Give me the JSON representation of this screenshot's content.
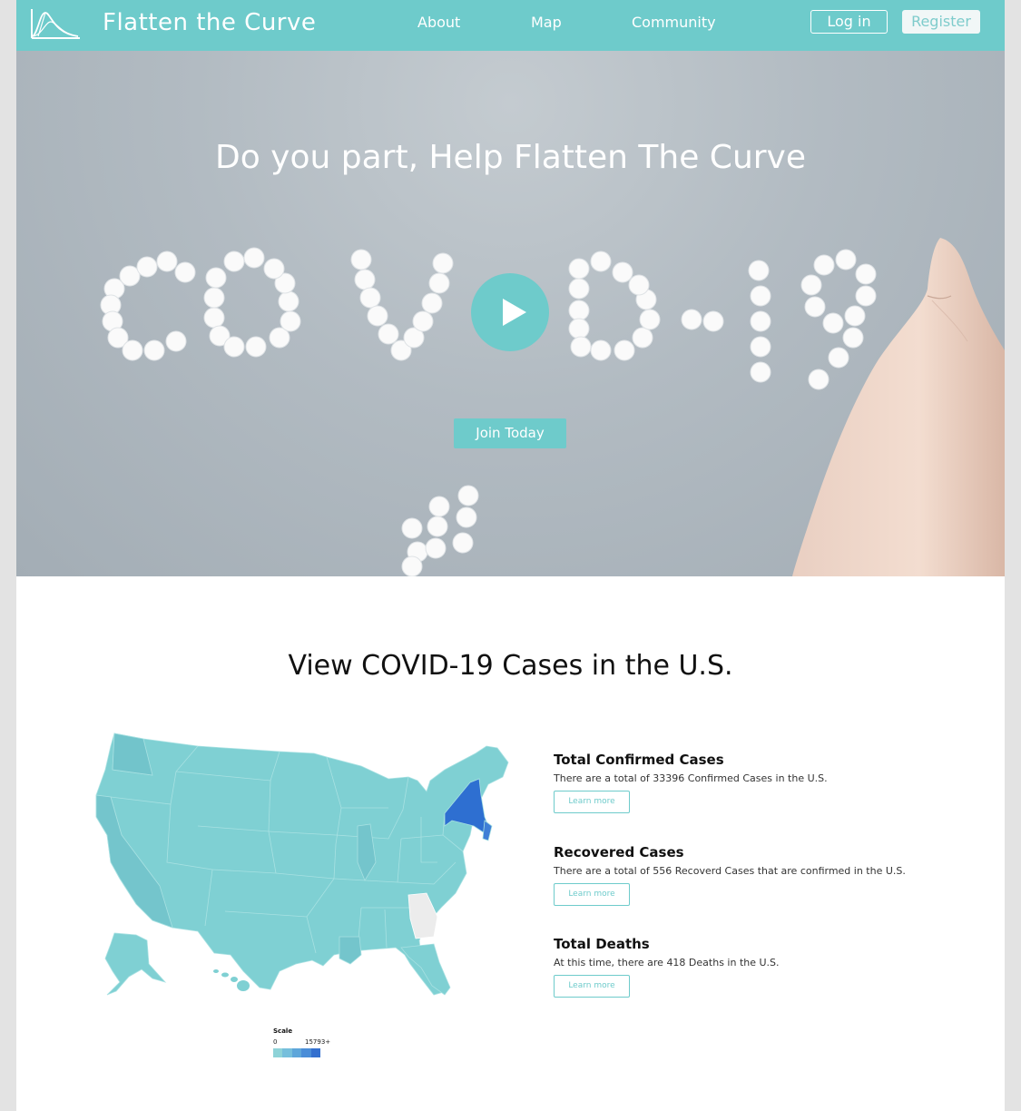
{
  "header": {
    "brand": "Flatten the Curve",
    "nav": [
      "About",
      "Map",
      "Community"
    ],
    "login_label": "Log in",
    "register_label": "Register"
  },
  "hero": {
    "title": "Do you part, Help Flatten The Curve",
    "cta_label": "Join Today"
  },
  "cases": {
    "title": "View COVID-19 Cases in the U.S.",
    "stats": [
      {
        "title": "Total Confirmed Cases",
        "text": "There are a total of 33396 Confirmed Cases  in the U.S.",
        "button": "Learn more"
      },
      {
        "title": "Recovered Cases",
        "text": "There are a total of 556 Recoverd Cases that are confirmed in the U.S.",
        "button": "Learn more"
      },
      {
        "title": "Total Deaths",
        "text": "At this time, there are 418 Deaths in the U.S.",
        "button": "Learn more"
      }
    ],
    "scale": {
      "title": "Scale",
      "min": "0",
      "max": "15793+"
    }
  },
  "colors": {
    "accent": "#6ecbcb",
    "map_base": "#7fd0d3",
    "map_high": "#2e6fd1",
    "map_nodata": "#ececec",
    "scale": [
      "#8ed3d8",
      "#76bfdc",
      "#5ea6da",
      "#4a8dd8",
      "#3470cf"
    ]
  }
}
